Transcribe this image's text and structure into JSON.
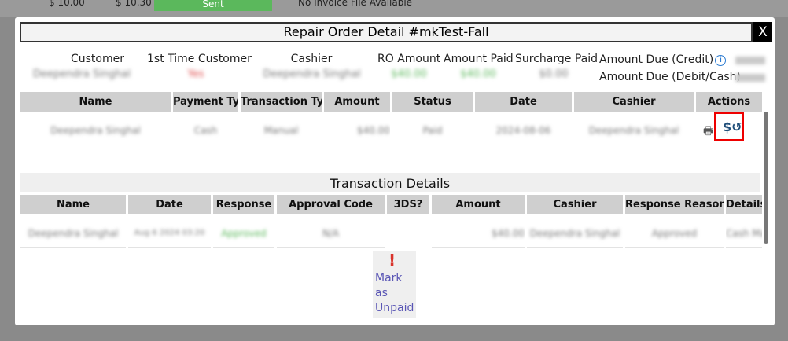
{
  "background": {
    "amount1": "$ 10.00",
    "amount2": "$ 10.30",
    "status": "Sent",
    "invoice": "No Invoice File Available"
  },
  "modal": {
    "title": "Repair Order Detail #mkTest-Fall",
    "close_label": "X"
  },
  "summary": {
    "customer_label": "Customer",
    "customer_value": "Deependra Singhal",
    "first_time_label": "1st Time Customer",
    "first_time_value": "Yes",
    "cashier_label": "Cashier",
    "cashier_value": "Deependra Singhal",
    "ro_amount_label": "RO Amount",
    "ro_amount_value": "$40.00",
    "amount_paid_label": "Amount Paid",
    "amount_paid_value": "$40.00",
    "surcharge_label": "Surcharge Paid",
    "surcharge_value": "$0.00",
    "due_credit_label": "Amount Due (Credit)",
    "due_debit_label": "Amount Due (Debit/Cash)",
    "colors": {
      "first_time": "#e05252",
      "paid": "#5cb85c"
    }
  },
  "payments": {
    "headers": [
      "Name",
      "Payment Type",
      "Transaction Type",
      "Amount",
      "Status",
      "Date",
      "Cashier",
      "Actions"
    ],
    "row": {
      "name": "Deependra Singhal",
      "payment_type": "Cash",
      "transaction_type": "Manual",
      "amount": "$40.00",
      "status": "Paid",
      "date": "2024-08-06",
      "cashier": "Deependra Singhal"
    }
  },
  "transaction_details": {
    "title": "Transaction Details",
    "headers": [
      "Name",
      "Date",
      "Response",
      "Approval Code",
      "3DS?",
      "Amount",
      "Cashier",
      "Response Reason",
      "Details"
    ],
    "row": {
      "name": "Deependra Singhal",
      "date": "Aug 6 2024 03:20 PM",
      "response": "Approved",
      "approval_code": "N/A",
      "amount": "$40.00",
      "cashier": "Deependra Singhal",
      "reason": "Approved",
      "details": "Cash Manual"
    }
  },
  "actions": {
    "mark_unpaid": "Mark as Unpaid",
    "print_icon": "printer-icon",
    "refund_icon": "refund-icon"
  }
}
